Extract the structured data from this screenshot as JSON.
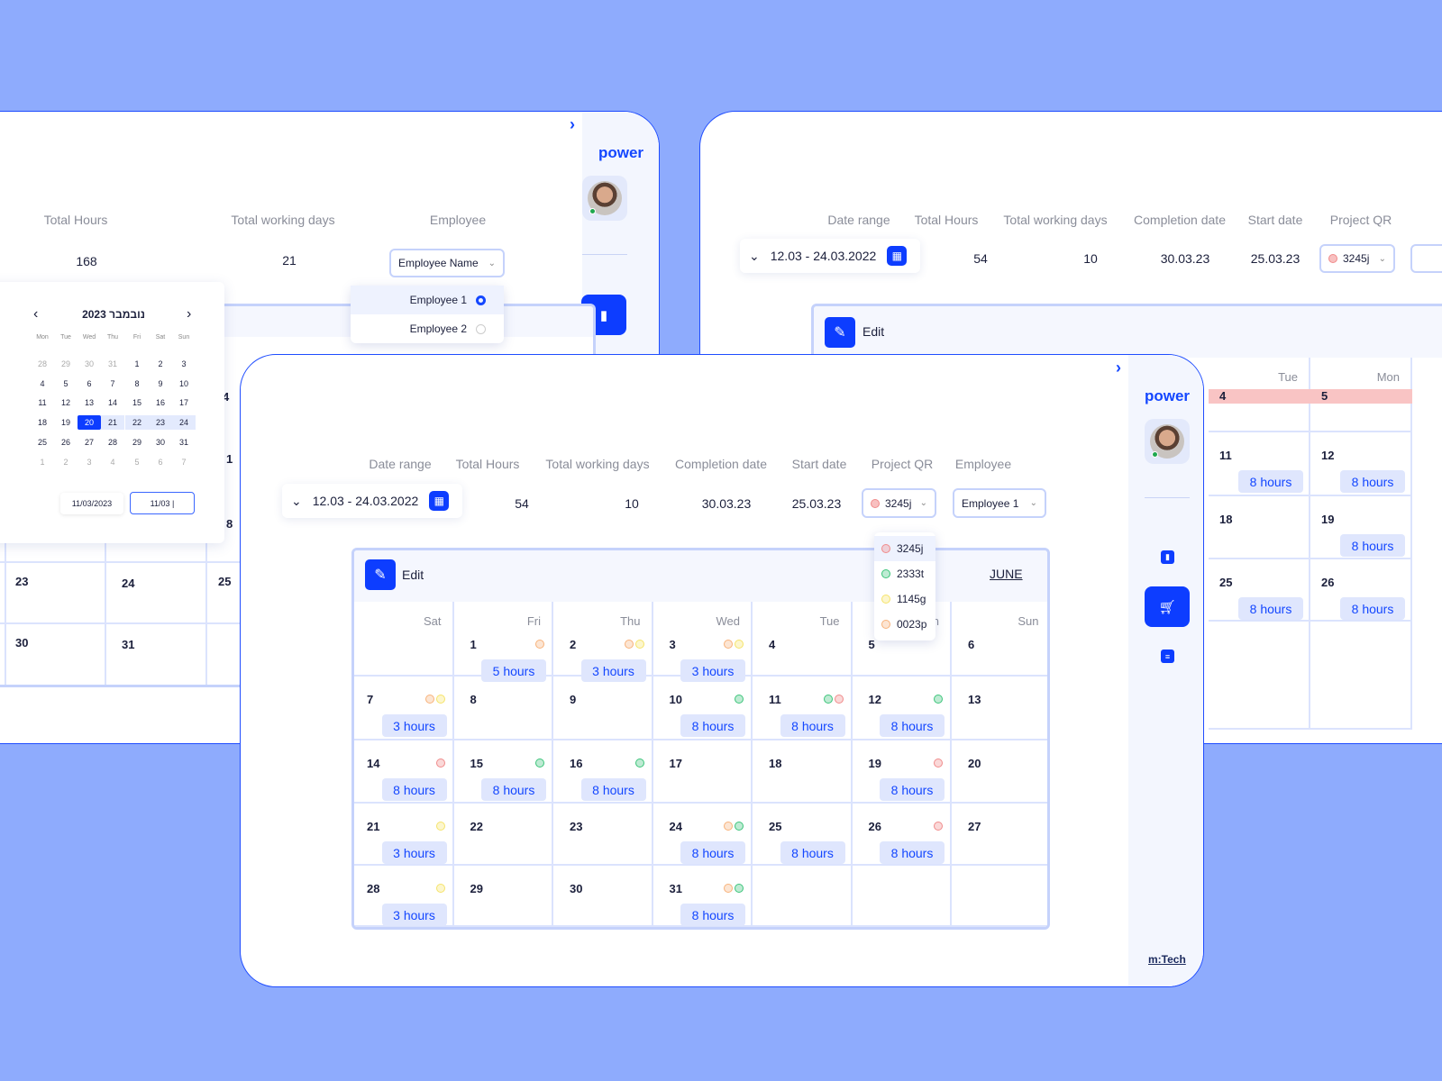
{
  "brand": {
    "name": "power",
    "logo": "m:Tech",
    "accent": "#0d3dff",
    "background": "#8eabfd"
  },
  "left_panel": {
    "labels": [
      "Total Hours",
      "Total working days",
      "Employee"
    ],
    "values": [
      "168",
      "21"
    ],
    "employee_dropdown": "Employee Name",
    "employee_options": [
      {
        "label": "Employee 1",
        "selected": true
      },
      {
        "label": "Employee 2",
        "selected": false
      }
    ],
    "mini_calendar": {
      "title": "נובמבר 2023",
      "weekdays": [
        "Mon",
        "Tue",
        "Wed",
        "Thu",
        "Fri",
        "Sat",
        "Sun"
      ],
      "weeks": [
        [
          "28",
          "29",
          "30",
          "31",
          "1",
          "2",
          "3"
        ],
        [
          "4",
          "5",
          "6",
          "7",
          "8",
          "9",
          "10"
        ],
        [
          "11",
          "12",
          "13",
          "14",
          "15",
          "16",
          "17"
        ],
        [
          "18",
          "19",
          "20",
          "21",
          "22",
          "23",
          "24"
        ],
        [
          "25",
          "26",
          "27",
          "28",
          "29",
          "30",
          "31"
        ],
        [
          "1",
          "2",
          "3",
          "4",
          "5",
          "6",
          "7"
        ]
      ],
      "selected": "20",
      "start_input": "11/03/2023",
      "end_input": "11/03 |"
    },
    "bg_dates": [
      "4",
      "1",
      "8",
      "23",
      "24",
      "25",
      "30",
      "31"
    ]
  },
  "right_panel": {
    "labels": [
      "Date range",
      "Total Hours",
      "Total working days",
      "Completion date",
      "Start date",
      "Project QR"
    ],
    "date_range": "12.03 - 24.03.2022",
    "values": [
      "54",
      "10",
      "30.03.23",
      "25.03.23"
    ],
    "project_qr": "3245j",
    "edit_label": "Edit",
    "weekdays": [
      "Tue",
      "Mon"
    ],
    "rows": [
      [
        {
          "d": "4",
          "hl": true
        },
        {
          "d": "5",
          "hl": true
        }
      ],
      [
        {
          "d": "11",
          "h": "8 hours"
        },
        {
          "d": "12",
          "h": "8 hours"
        }
      ],
      [
        {
          "d": "18"
        },
        {
          "d": "19",
          "h": "8 hours"
        }
      ],
      [
        {
          "d": "25",
          "h": "8 hours"
        },
        {
          "d": "26",
          "h": "8 hours"
        }
      ],
      [
        {},
        {}
      ]
    ]
  },
  "main_panel": {
    "labels": [
      "Date range",
      "Total Hours",
      "Total working days",
      "Completion date",
      "Start date",
      "Project QR",
      "Employee"
    ],
    "date_range": "12.03 - 24.03.2022",
    "values": [
      "54",
      "10",
      "30.03.23",
      "25.03.23"
    ],
    "project_qr": "3245j",
    "employee": "Employee 1",
    "qr_options": [
      {
        "label": "3245j",
        "color": "red"
      },
      {
        "label": "2333t",
        "color": "green"
      },
      {
        "label": "1145g",
        "color": "yellow"
      },
      {
        "label": "0023p",
        "color": "orange"
      }
    ],
    "edit_label": "Edit",
    "month": "JUNE",
    "weekdays": [
      "Sat",
      "Fri",
      "Thu",
      "Wed",
      "Tue",
      "Mon",
      "Sun"
    ],
    "dot_colors": {
      "red": "#f08a8a",
      "green": "#3cc47a",
      "yellow": "#f5e36a",
      "orange": "#f7b27a"
    },
    "weeks": [
      [
        {},
        {
          "d": "1",
          "dots": [
            "orange"
          ],
          "h": "5 hours"
        },
        {
          "d": "2",
          "dots": [
            "orange",
            "yellow"
          ],
          "h": "3 hours"
        },
        {
          "d": "3",
          "dots": [
            "orange",
            "yellow"
          ],
          "h": "3 hours"
        },
        {
          "d": "4"
        },
        {
          "d": "5"
        },
        {
          "d": "6"
        }
      ],
      [
        {
          "d": "7",
          "dots": [
            "orange",
            "yellow"
          ],
          "h": "3 hours"
        },
        {
          "d": "8"
        },
        {
          "d": "9"
        },
        {
          "d": "10",
          "dots": [
            "green"
          ],
          "h": "8 hours"
        },
        {
          "d": "11",
          "dots": [
            "green",
            "red"
          ],
          "h": "8 hours"
        },
        {
          "d": "12",
          "dots": [
            "green"
          ],
          "h": "8 hours"
        },
        {
          "d": "13"
        }
      ],
      [
        {
          "d": "14",
          "dots": [
            "red"
          ],
          "h": "8 hours"
        },
        {
          "d": "15",
          "dots": [
            "green"
          ],
          "h": "8 hours"
        },
        {
          "d": "16",
          "dots": [
            "green"
          ],
          "h": "8 hours"
        },
        {
          "d": "17"
        },
        {
          "d": "18"
        },
        {
          "d": "19",
          "dots": [
            "red"
          ],
          "h": "8 hours"
        },
        {
          "d": "20"
        }
      ],
      [
        {
          "d": "21",
          "dots": [
            "yellow"
          ],
          "h": "3 hours"
        },
        {
          "d": "22"
        },
        {
          "d": "23"
        },
        {
          "d": "24",
          "dots": [
            "orange",
            "green"
          ],
          "h": "8 hours"
        },
        {
          "d": "25",
          "h": "8 hours"
        },
        {
          "d": "26",
          "dots": [
            "red"
          ],
          "h": "8 hours"
        },
        {
          "d": "27"
        }
      ],
      [
        {
          "d": "28",
          "dots": [
            "yellow"
          ],
          "h": "3 hours"
        },
        {
          "d": "29"
        },
        {
          "d": "30"
        },
        {
          "d": "31",
          "dots": [
            "orange",
            "green"
          ],
          "h": "8 hours"
        },
        {},
        {},
        {}
      ]
    ]
  }
}
